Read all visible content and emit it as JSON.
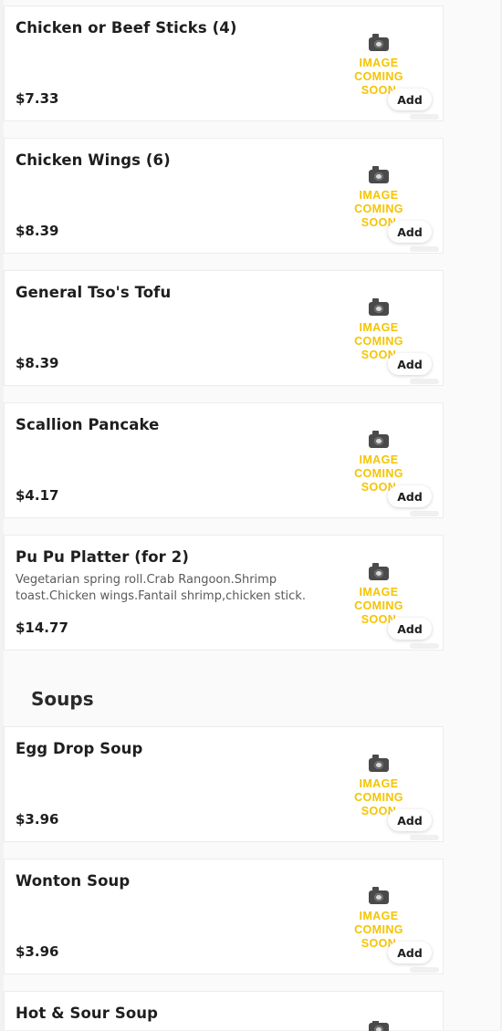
{
  "sections": {
    "soups_title": "Soups"
  },
  "placeholder": {
    "line1": "IMAGE",
    "line2": "COMING SOON"
  },
  "appetizers": [
    {
      "name": "Chicken or Beef Sticks (4)",
      "price": "$7.33",
      "description": "",
      "add_label": "Add"
    },
    {
      "name": "Chicken Wings (6)",
      "price": "$8.39",
      "description": "",
      "add_label": "Add"
    },
    {
      "name": "General Tso's Tofu",
      "price": "$8.39",
      "description": "",
      "add_label": "Add"
    },
    {
      "name": "Scallion Pancake",
      "price": "$4.17",
      "description": "",
      "add_label": "Add"
    },
    {
      "name": "Pu Pu Platter (for 2)",
      "price": "$14.77",
      "description": "Vegetarian spring roll.Crab Rangoon.Shrimp toast.Chicken wings.Fantail shrimp,chicken stick.",
      "add_label": "Add"
    }
  ],
  "soups": [
    {
      "name": "Egg Drop Soup",
      "price": "$3.96",
      "add_label": "Add"
    },
    {
      "name": "Wonton Soup",
      "price": "$3.96",
      "add_label": "Add"
    },
    {
      "name": "Hot & Sour Soup"
    }
  ],
  "colors": {
    "placeholder_text": "#f5c400",
    "card_bg": "#ffffff",
    "page_bg": "#fafafa"
  }
}
